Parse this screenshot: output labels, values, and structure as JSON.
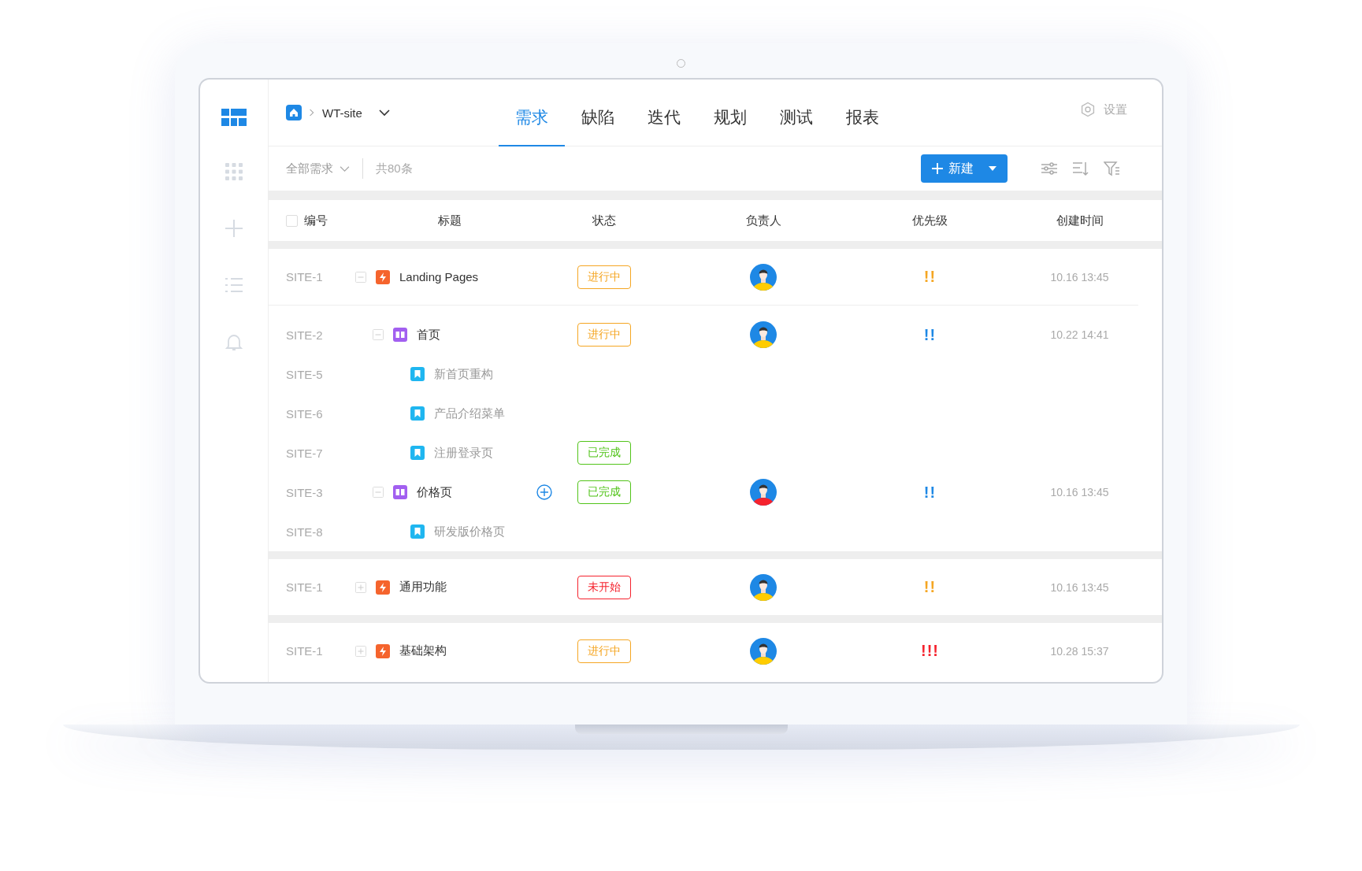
{
  "breadcrumb": {
    "project": "WT-site"
  },
  "tabs": [
    {
      "label": "需求",
      "selected": true
    },
    {
      "label": "缺陷",
      "selected": false
    },
    {
      "label": "迭代",
      "selected": false
    },
    {
      "label": "规划",
      "selected": false
    },
    {
      "label": "测试",
      "selected": false
    },
    {
      "label": "报表",
      "selected": false
    }
  ],
  "settings": {
    "label": "设置"
  },
  "toolbar": {
    "filter": "全部需求",
    "count": "共80条",
    "new_button": "新建"
  },
  "table": {
    "select_all": {
      "checked": false
    },
    "columns": [
      "编号",
      "标题",
      "状态",
      "负责人",
      "优先级",
      "创建时间"
    ],
    "groups": [
      {
        "rows": [
          {
            "id": "SITE-1",
            "kind": "epic",
            "title": "Landing Pages",
            "expanded": true,
            "hovered": false,
            "status": {
              "text": "进行中",
              "color": "#f5a623"
            },
            "assignee": {
              "color": "#ffcc00"
            },
            "priority": {
              "text": "!!",
              "color": "#f5a623"
            },
            "created": "10.16 13:45",
            "children": [
              {
                "id": "SITE-2",
                "kind": "feature",
                "title": "首页",
                "expanded": true,
                "hovered": false,
                "status": {
                  "text": "进行中",
                  "color": "#f5a623"
                },
                "assignee": {
                  "color": "#ffcc00"
                },
                "priority": {
                  "text": "!!",
                  "color": "#1e88e5"
                },
                "created": "10.22 14:41",
                "children": [
                  {
                    "id": "SITE-5",
                    "kind": "story",
                    "title": "新首页重构",
                    "hovered": false
                  },
                  {
                    "id": "SITE-6",
                    "kind": "story",
                    "title": "产品介绍菜单",
                    "hovered": false
                  },
                  {
                    "id": "SITE-7",
                    "kind": "story",
                    "title": "注册登录页",
                    "hovered": false,
                    "status": {
                      "text": "已完成",
                      "color": "#52c41a"
                    }
                  }
                ]
              },
              {
                "id": "SITE-3",
                "kind": "feature",
                "title": "价格页",
                "expanded": true,
                "hovered": true,
                "status": {
                  "text": "已完成",
                  "color": "#52c41a"
                },
                "assignee": {
                  "color": "#f5222d"
                },
                "priority": {
                  "text": "!!",
                  "color": "#1e88e5"
                },
                "created": "10.16 13:45",
                "children": [
                  {
                    "id": "SITE-8",
                    "kind": "story",
                    "title": "研发版价格页",
                    "hovered": false
                  }
                ]
              }
            ]
          }
        ]
      },
      {
        "rows": [
          {
            "id": "SITE-1",
            "kind": "epic",
            "title": "通用功能",
            "expanded": false,
            "hovered": false,
            "status": {
              "text": "未开始",
              "color": "#f5222d"
            },
            "assignee": {
              "color": "#ffcc00"
            },
            "priority": {
              "text": "!!",
              "color": "#f5a623"
            },
            "created": "10.16 13:45"
          }
        ]
      },
      {
        "rows": [
          {
            "id": "SITE-1",
            "kind": "epic",
            "title": "基础架构",
            "expanded": false,
            "hovered": false,
            "status": {
              "text": "进行中",
              "color": "#f5a623"
            },
            "assignee": {
              "color": "#ffcc00"
            },
            "priority": {
              "text": "!!!",
              "color": "#f5222d"
            },
            "created": "10.28 15:37"
          }
        ]
      }
    ]
  }
}
